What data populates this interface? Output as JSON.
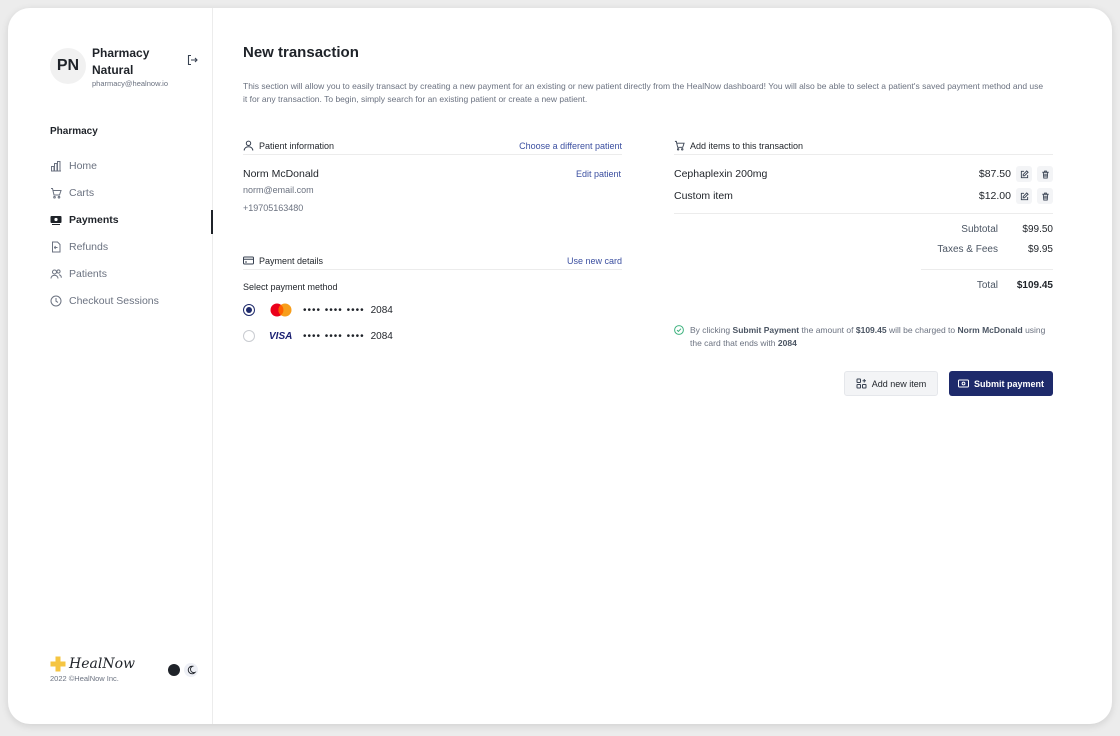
{
  "profile": {
    "initials": "PN",
    "name": "Pharmacy Natural",
    "email": "pharmacy@healnow.io"
  },
  "nav": {
    "heading": "Pharmacy",
    "items": [
      {
        "label": "Home",
        "icon": "bar-chart-icon"
      },
      {
        "label": "Carts",
        "icon": "cart-icon"
      },
      {
        "label": "Payments",
        "icon": "payments-icon"
      },
      {
        "label": "Refunds",
        "icon": "refund-icon"
      },
      {
        "label": "Patients",
        "icon": "users-icon"
      },
      {
        "label": "Checkout Sessions",
        "icon": "clock-icon"
      }
    ],
    "active": "Payments"
  },
  "brand": {
    "name": "HealNow",
    "copyright": "2022 ©HealNow Inc."
  },
  "page": {
    "title": "New transaction",
    "description": "This section will allow you to easily transact by creating a new payment for an existing or new patient directly from the HealNow dashboard! You will also be able to select a patient's saved payment method and use it for any transaction. To begin, simply search for an existing patient or create a new patient."
  },
  "patient": {
    "section_title": "Patient information",
    "change_link": "Choose a different patient",
    "edit_link": "Edit patient",
    "name": "Norm McDonald",
    "email": "norm@email.com",
    "phone": "+19705163480"
  },
  "payment": {
    "section_title": "Payment details",
    "new_card_link": "Use new card",
    "method_label": "Select payment method",
    "cards": [
      {
        "brand": "mastercard",
        "masked": "•••• •••• ••••",
        "last4": "2084",
        "selected": true
      },
      {
        "brand": "VISA",
        "masked": "•••• •••• ••••",
        "last4": "2084",
        "selected": false
      }
    ]
  },
  "items": {
    "section_title": "Add items to this transaction",
    "list": [
      {
        "name": "Cephaplexin 200mg",
        "price": "$87.50"
      },
      {
        "name": "Custom item",
        "price": "$12.00"
      }
    ]
  },
  "summary": {
    "subtotal_label": "Subtotal",
    "subtotal": "$99.50",
    "taxes_label": "Taxes & Fees",
    "taxes": "$9.95",
    "total_label": "Total",
    "total": "$109.45"
  },
  "notice": {
    "part1": "By clicking",
    "action": "Submit Payment",
    "part2": "the amount of",
    "amount": "$109.45",
    "part3": "will be charged to",
    "name": "Norm McDonald",
    "part4": "using the card that ends with",
    "last4": "2084"
  },
  "actions": {
    "add_item": "Add new item",
    "submit": "Submit payment"
  },
  "colors": {
    "primary": "#1e2a6b",
    "link": "#3b4fa0",
    "success": "#3fb27f"
  }
}
